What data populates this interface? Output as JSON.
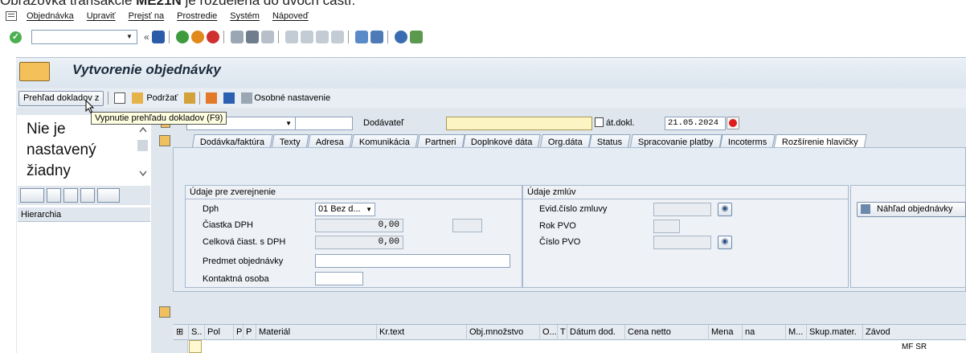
{
  "caption": {
    "prefix": "Obrazovka transakcie ",
    "bold": "ME21N",
    "suffix": " je rozdelená do dvoch častí."
  },
  "menu": [
    "Objednávka",
    "Upraviť",
    "Prejsť na",
    "Prostredie",
    "Systém",
    "Nápoveď"
  ],
  "title": "Vytvorenie objednávky",
  "app_toolbar": {
    "doc_overview": "Prehľad dokladov z",
    "hold": "Podržať",
    "personal_settings": "Osobné nastavenie"
  },
  "tooltip": "Vypnutie prehľadu dokladov  (F9)",
  "left_panel": {
    "message": "Nie je nastavený žiadny",
    "hierarchy": "Hierarchia"
  },
  "header": {
    "doc_type_value": "",
    "supplier_label": "Dodávateľ",
    "supplier_value": "",
    "doc_date_label": "át.dokl.",
    "doc_date_value": "21.05.2024"
  },
  "tabs": [
    "Dodávka/faktúra",
    "Texty",
    "Adresa",
    "Komunikácia",
    "Partneri",
    "Doplnkové dáta",
    "Org.dáta",
    "Status",
    "Spracovanie platby",
    "Incoterms",
    "Rozšírenie hlavičky"
  ],
  "active_tab": "Rozšírenie hlavičky",
  "publication": {
    "title": "Údaje pre zverejnenie",
    "dph_label": "Dph",
    "dph_value": "01 Bez d...",
    "vat_amount_label": "Čiastka DPH",
    "vat_amount_value": "0,00",
    "total_label": "Celková čiast. s DPH",
    "total_value": "0,00",
    "subject_label": "Predmet objednávky",
    "contact_label": "Kontaktná osoba"
  },
  "contracts": {
    "title": "Údaje zmlúv",
    "evid_label": "Evid.číslo zmluvy",
    "year_label": "Rok PVO",
    "pvo_label": "Číslo PVO"
  },
  "preview_button": "Náhľad objednávky",
  "table": {
    "columns": [
      "S..",
      "Pol",
      "P",
      "P",
      "Materiál",
      "Kr.text",
      "Obj.množstvo",
      "O...",
      "T",
      "Dátum dod.",
      "Cena netto",
      "Mena",
      "na",
      "M...",
      "Skup.mater.",
      "Závod"
    ],
    "row_plant": "MF SR"
  }
}
